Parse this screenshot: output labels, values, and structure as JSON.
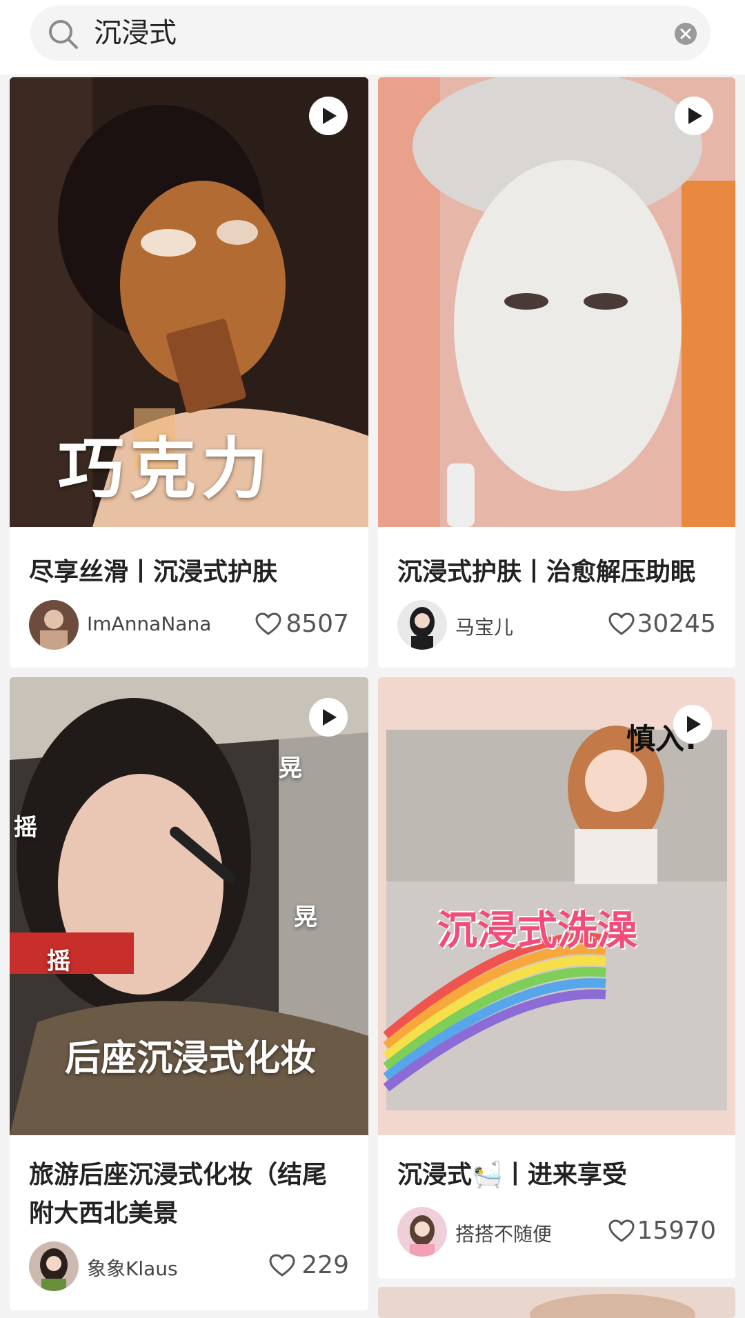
{
  "search": {
    "query": "沉浸式"
  },
  "colors": {
    "accent_white": "#ffffff",
    "text_primary": "#222222",
    "text_secondary": "#555555"
  },
  "feed": [
    {
      "title": "尽享丝滑丨沉浸式护肤",
      "cover_text": "巧克力",
      "author": "ImAnnaNana",
      "likes": "8507",
      "has_video": true
    },
    {
      "title": "沉浸式护肤丨治愈解压助眠",
      "cover_text": "",
      "author": "马宝儿",
      "likes": "30245",
      "has_video": true
    },
    {
      "title": "旅游后座沉浸式化妆（结尾附大西北美景",
      "cover_text": "后座沉浸式化妆",
      "cover_tags": [
        "摇",
        "晃",
        "晃",
        "摇"
      ],
      "author": "象象Klaus",
      "likes": "229",
      "has_video": true
    },
    {
      "title": "沉浸式🛀丨进来享受",
      "cover_text": "沉浸式洗澡",
      "cover_corner_text": "慎入!",
      "author": "搭搭不随便",
      "likes": "15970",
      "has_video": true
    }
  ],
  "icons": [
    "search-icon",
    "clear-icon",
    "play-icon",
    "heart-icon",
    "avatar"
  ]
}
